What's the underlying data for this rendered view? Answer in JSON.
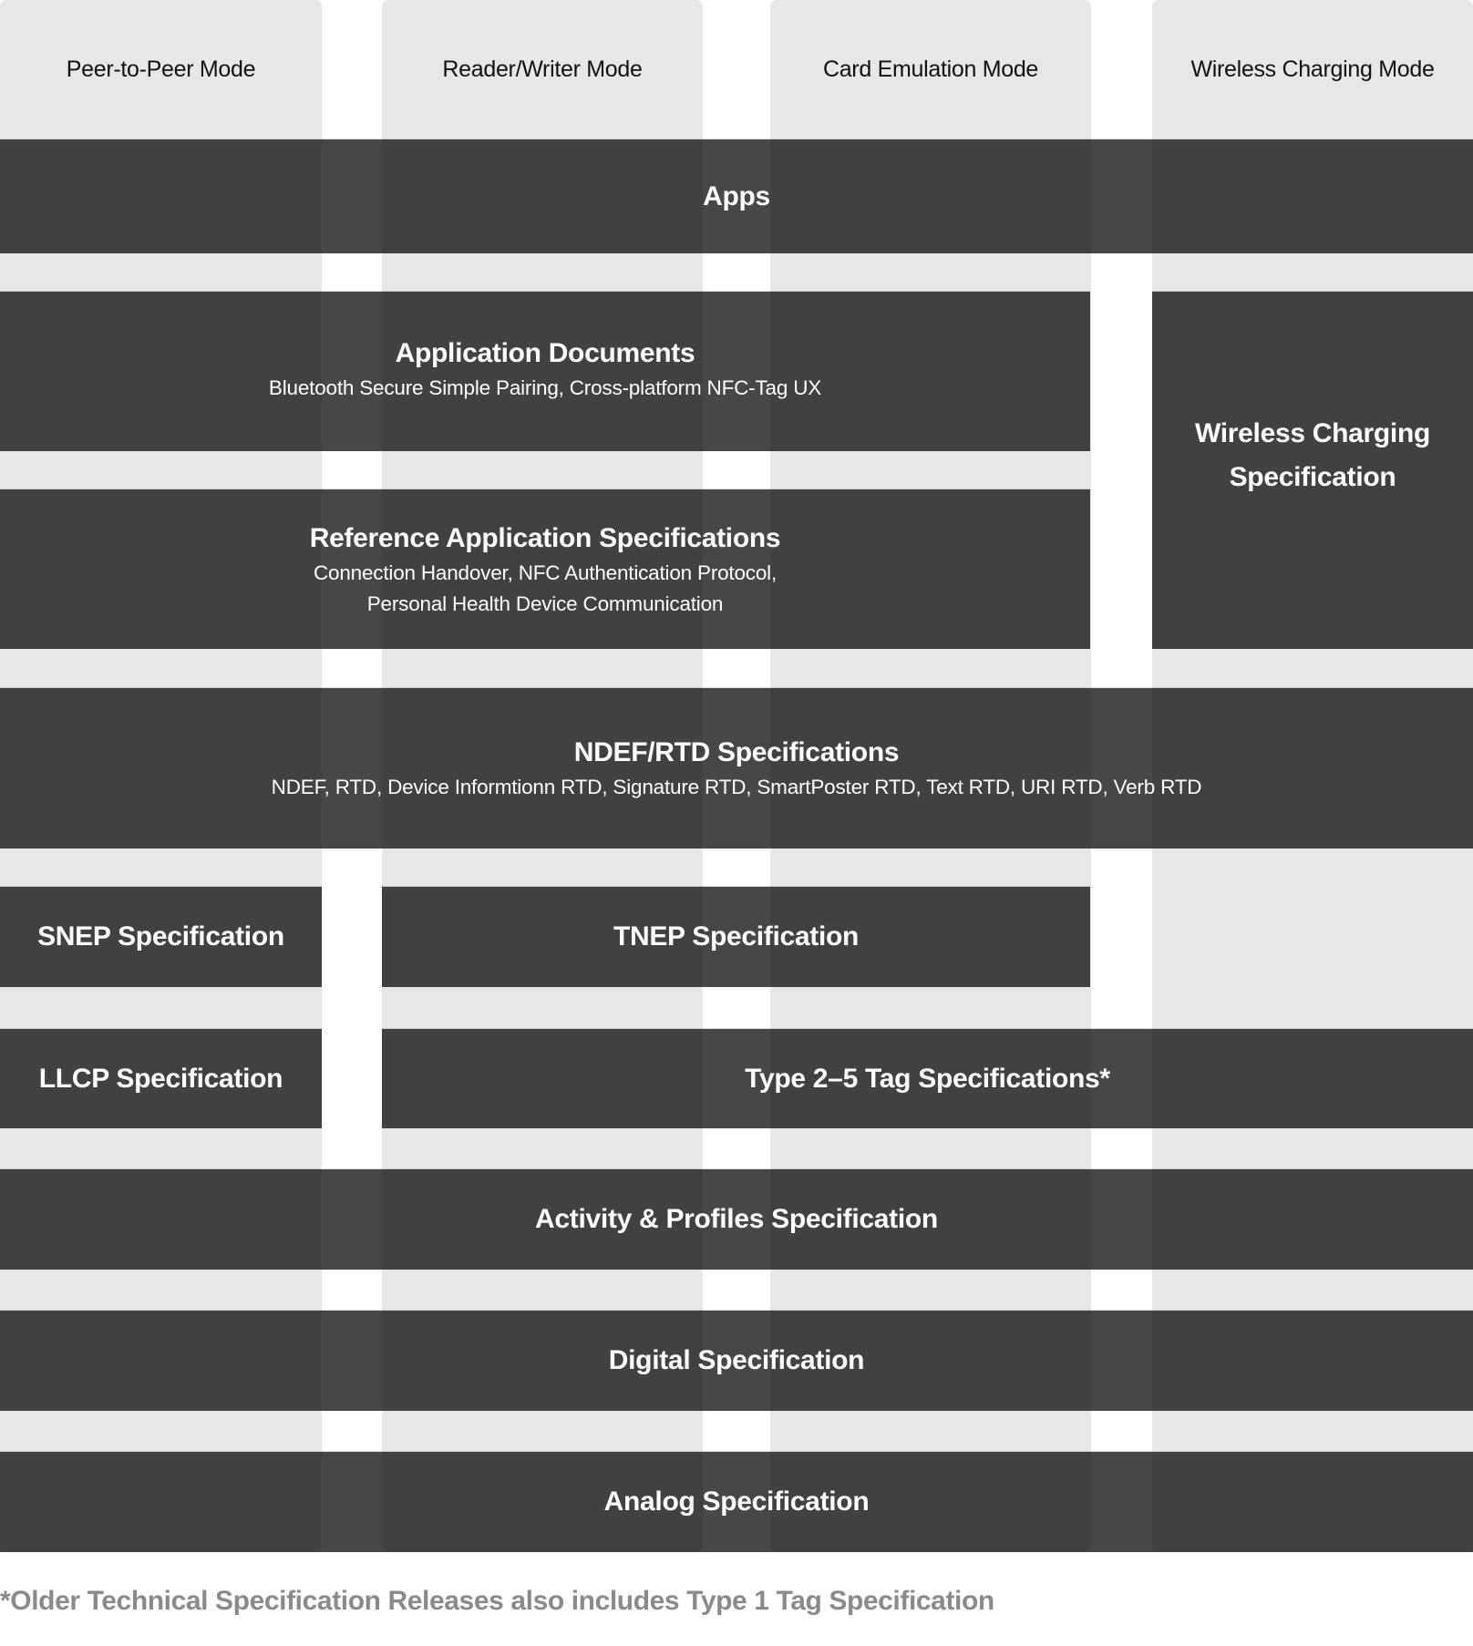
{
  "diagram": {
    "modes": [
      {
        "label": "Peer-to-Peer Mode"
      },
      {
        "label": "Reader/Writer Mode"
      },
      {
        "label": "Card Emulation Mode"
      },
      {
        "label": "Wireless Charging Mode"
      }
    ],
    "layers": {
      "apps": {
        "title": "Apps"
      },
      "application_documents": {
        "title": "Application Documents",
        "subtitle": "Bluetooth Secure Simple Pairing, Cross-platform NFC-Tag UX"
      },
      "reference_application_specifications": {
        "title": "Reference Application Specifications",
        "subtitle_lines": [
          "Connection Handover, NFC Authentication Protocol,",
          "Personal Health Device Communication"
        ]
      },
      "wireless_charging_specification": {
        "title_lines": [
          "Wireless Charging",
          "Specification"
        ]
      },
      "ndef_rtd_specifications": {
        "title": "NDEF/RTD Specifications",
        "subtitle": "NDEF, RTD, Device Informtionn RTD, Signature RTD, SmartPoster RTD, Text RTD, URI RTD, Verb RTD"
      },
      "snep_specification": {
        "title": "SNEP Specification"
      },
      "tnep_specification": {
        "title": "TNEP Specification"
      },
      "llcp_specification": {
        "title": "LLCP Specification"
      },
      "type_2_5_tag_specifications": {
        "title": "Type 2–5 Tag Specifications*"
      },
      "activity_profiles_specification": {
        "title": "Activity & Profiles Specification"
      },
      "digital_specification": {
        "title": "Digital Specification"
      },
      "analog_specification": {
        "title": "Analog Specification"
      }
    },
    "footnote": "*Older Technical Specification Releases also includes Type 1 Tag Specification"
  },
  "colors": {
    "column_background": "#e7e7e7",
    "layer_background": "#414141",
    "layer_text": "#ffffff",
    "header_text": "#111111",
    "footnote_text": "#8a8a8a"
  }
}
